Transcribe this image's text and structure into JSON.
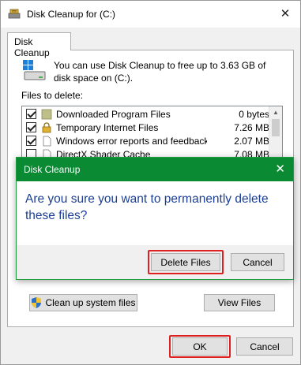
{
  "window": {
    "title": "Disk Cleanup for  (C:)",
    "tab_label": "Disk Cleanup"
  },
  "intro": {
    "text": "You can use Disk Cleanup to free up to 3.63 GB of disk space on  (C:)."
  },
  "files": {
    "label": "Files to delete:",
    "items": [
      {
        "name": "Downloaded Program Files",
        "size": "0 bytes",
        "checked": true
      },
      {
        "name": "Temporary Internet Files",
        "size": "7.26 MB",
        "checked": true
      },
      {
        "name": "Windows error reports and feedback di...",
        "size": "2.07 MB",
        "checked": true
      },
      {
        "name": "DirectX Shader Cache",
        "size": "7.08 MB",
        "checked": false
      }
    ]
  },
  "buttons": {
    "cleanup_system": "Clean up system files",
    "view_files": "View Files",
    "ok": "OK",
    "cancel": "Cancel"
  },
  "dialog": {
    "title": "Disk Cleanup",
    "message": "Are you sure you want to permanently delete these files?",
    "delete_label": "Delete Files",
    "cancel_label": "Cancel"
  },
  "colors": {
    "dialog_title_bg": "#0b8a34",
    "message_text": "#1c3f95",
    "highlight": "#e02020"
  }
}
